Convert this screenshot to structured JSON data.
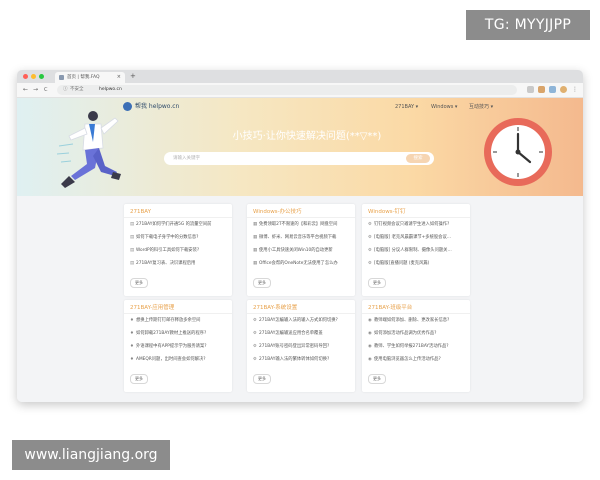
{
  "watermarks": {
    "top_right": "TG: MYYJJPP",
    "bottom_left": "www.liangjiang.org"
  },
  "browser": {
    "tab_title": "首页 | 帮我.FAQ",
    "tab_close": "×",
    "new_tab": "+",
    "nav_back": "←",
    "nav_forward": "→",
    "nav_reload": "C",
    "url_security": "不安全",
    "url_host": "helpwo.cn"
  },
  "site": {
    "brand": "帮我 helpwo.cn",
    "nav": [
      "271BAY ▾",
      "Windows ▾",
      "互动技巧 ▾"
    ],
    "headline": "小技巧·让你快速解决问题(**▽**)",
    "search_placeholder": "请输入关键字",
    "search_button": "搜索"
  },
  "colors": {
    "accent": "#e8a24c",
    "clock_ring": "#e86a5a",
    "hero_left": "#dff0f2",
    "hero_right": "#f4b98e"
  },
  "cards": [
    {
      "title": "271BAY",
      "icon": "book-icon",
      "more": "更多",
      "items": [
        "271BAY如何学们开通5G 的流量空间前",
        "如何下载电子身学中的分数信息?",
        "WordP的科引工具如何下载安装?",
        "271BAY复习表、决识课程后用"
      ]
    },
    {
      "title": "Windows-办公技巧",
      "icon": "doc-icon",
      "more": "更多",
      "items": [
        "免费领取2T不限速的【和彩云】网盘空间",
        "微博、虾米、网易云音乐等平台视频下载",
        "使用小工具快速关闭Win10的自动更新",
        "Office会帮的OneNote无法使用了怎么办"
      ]
    },
    {
      "title": "Windows-钉钉",
      "icon": "gear-icon",
      "more": "更多",
      "items": [
        "钉钉视频会议只邀请学生进入如何操作?",
        "[电脑版] 老克风晨霸课节+多统股会议…",
        "[电脑版] 分议人群限制、摄像头问题关…",
        "[电脑版]直播问题 (麦克风篇)"
      ]
    },
    {
      "title": "271BAY-应用管理",
      "icon": "bulb-icon",
      "more": "更多",
      "items": [
        "想换上传期钉钉邮存释放多余空间",
        "如何卸载271BAY教材上推送的程序?",
        "外语课程中有APP提示学为服务请案?",
        "AMEQR问题，出时间查会如何解决?"
      ]
    },
    {
      "title": "271BAY-系统设置",
      "icon": "gear-icon",
      "more": "更多",
      "items": [
        "271BAY怎编输入法的输入方式如何切换?",
        "271BAY怎编输送应用合名单覆盖",
        "271BAY账号密码登出异常密码导回?",
        "271BAY输入法的繁体转体如何切换?"
      ]
    },
    {
      "title": "271BAY-班级平台",
      "icon": "globe-icon",
      "more": "更多",
      "items": [
        "教师端如何添加、删除、更改家长信息?",
        "如何添加活动作品调为优秀作品?",
        "教师、学生如何举报271BAY活动作品?",
        "使用电脑浏览器怎么上传活动作品?"
      ]
    }
  ]
}
